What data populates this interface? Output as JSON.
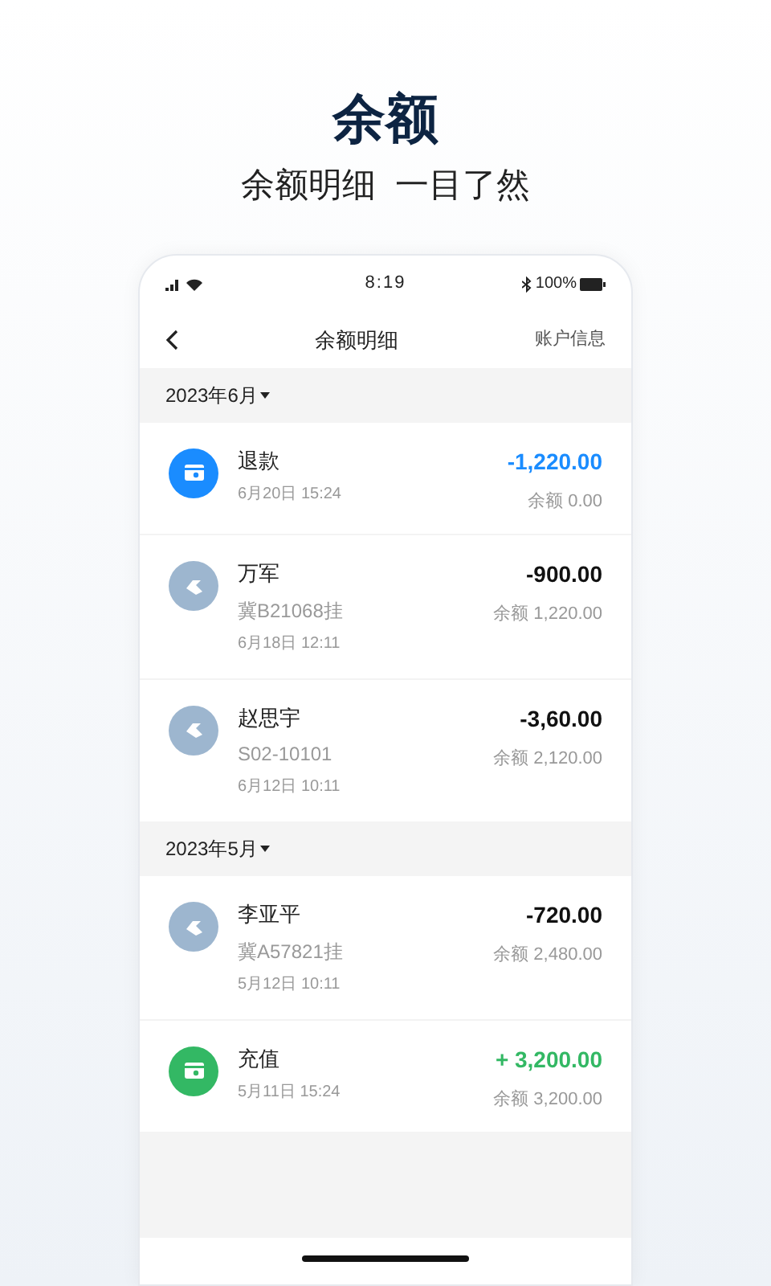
{
  "hero": {
    "title": "余额",
    "subtitle": "余额明细  一目了然"
  },
  "status_bar": {
    "time": "8:19",
    "battery": "100%"
  },
  "nav": {
    "title": "余额明细",
    "action": "账户信息"
  },
  "groups": [
    {
      "month": "2023年6月",
      "items": [
        {
          "kind": "refund",
          "name": "退款",
          "time": "6月20日 15:24",
          "amount": "-1,220.00",
          "balance": "余额 0.00"
        },
        {
          "kind": "transfer",
          "name": "万军",
          "plate": "冀B21068挂",
          "time": "6月18日 12:11",
          "amount": "-900.00",
          "balance": "余额 1,220.00"
        },
        {
          "kind": "transfer",
          "name": "赵思宇",
          "plate": "S02-10101",
          "time": "6月12日 10:11",
          "amount": "-3,60.00",
          "balance": "余额 2,120.00"
        }
      ]
    },
    {
      "month": "2023年5月",
      "items": [
        {
          "kind": "transfer",
          "name": "李亚平",
          "plate": "冀A57821挂",
          "time": "5月12日 10:11",
          "amount": "-720.00",
          "balance": "余额 2,480.00"
        },
        {
          "kind": "recharge",
          "name": "充值",
          "time": "5月11日 15:24",
          "amount": "+ 3,200.00",
          "balance": "余额 3,200.00"
        }
      ]
    }
  ]
}
